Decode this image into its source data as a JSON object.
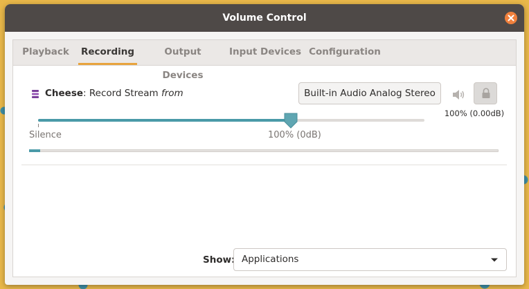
{
  "window": {
    "title": "Volume Control"
  },
  "tabs": [
    {
      "label": "Playback",
      "active": false
    },
    {
      "label": "Recording",
      "active": true
    },
    {
      "label": "Output Devices",
      "active": false
    },
    {
      "label": "Input Devices",
      "active": false
    },
    {
      "label": "Configuration",
      "active": false
    }
  ],
  "stream": {
    "app_name": "Cheese",
    "separator": ": ",
    "stream_name": "Record Stream",
    "from_label": "from",
    "device_button_label": "Built-in Audio Analog Stereo",
    "level_readout": "100% (0.00dB)",
    "volume_fraction": 0.655,
    "scale_min_label": "Silence",
    "scale_100_label": "100% (0dB)",
    "peak_fraction": 0.023,
    "icons": {
      "app": "cheese-app-icon",
      "mute": "speaker-mute-toggle-icon",
      "lock": "lock-channels-icon"
    }
  },
  "footer": {
    "show_label": "Show:",
    "show_value": "Applications"
  },
  "colors": {
    "titlebar": "#4e4947",
    "close_button": "#f0803c",
    "tab_active_underline": "#e8a33d",
    "slider_fill": "#4a9aa8",
    "app_icon": "#7a3f9a"
  }
}
